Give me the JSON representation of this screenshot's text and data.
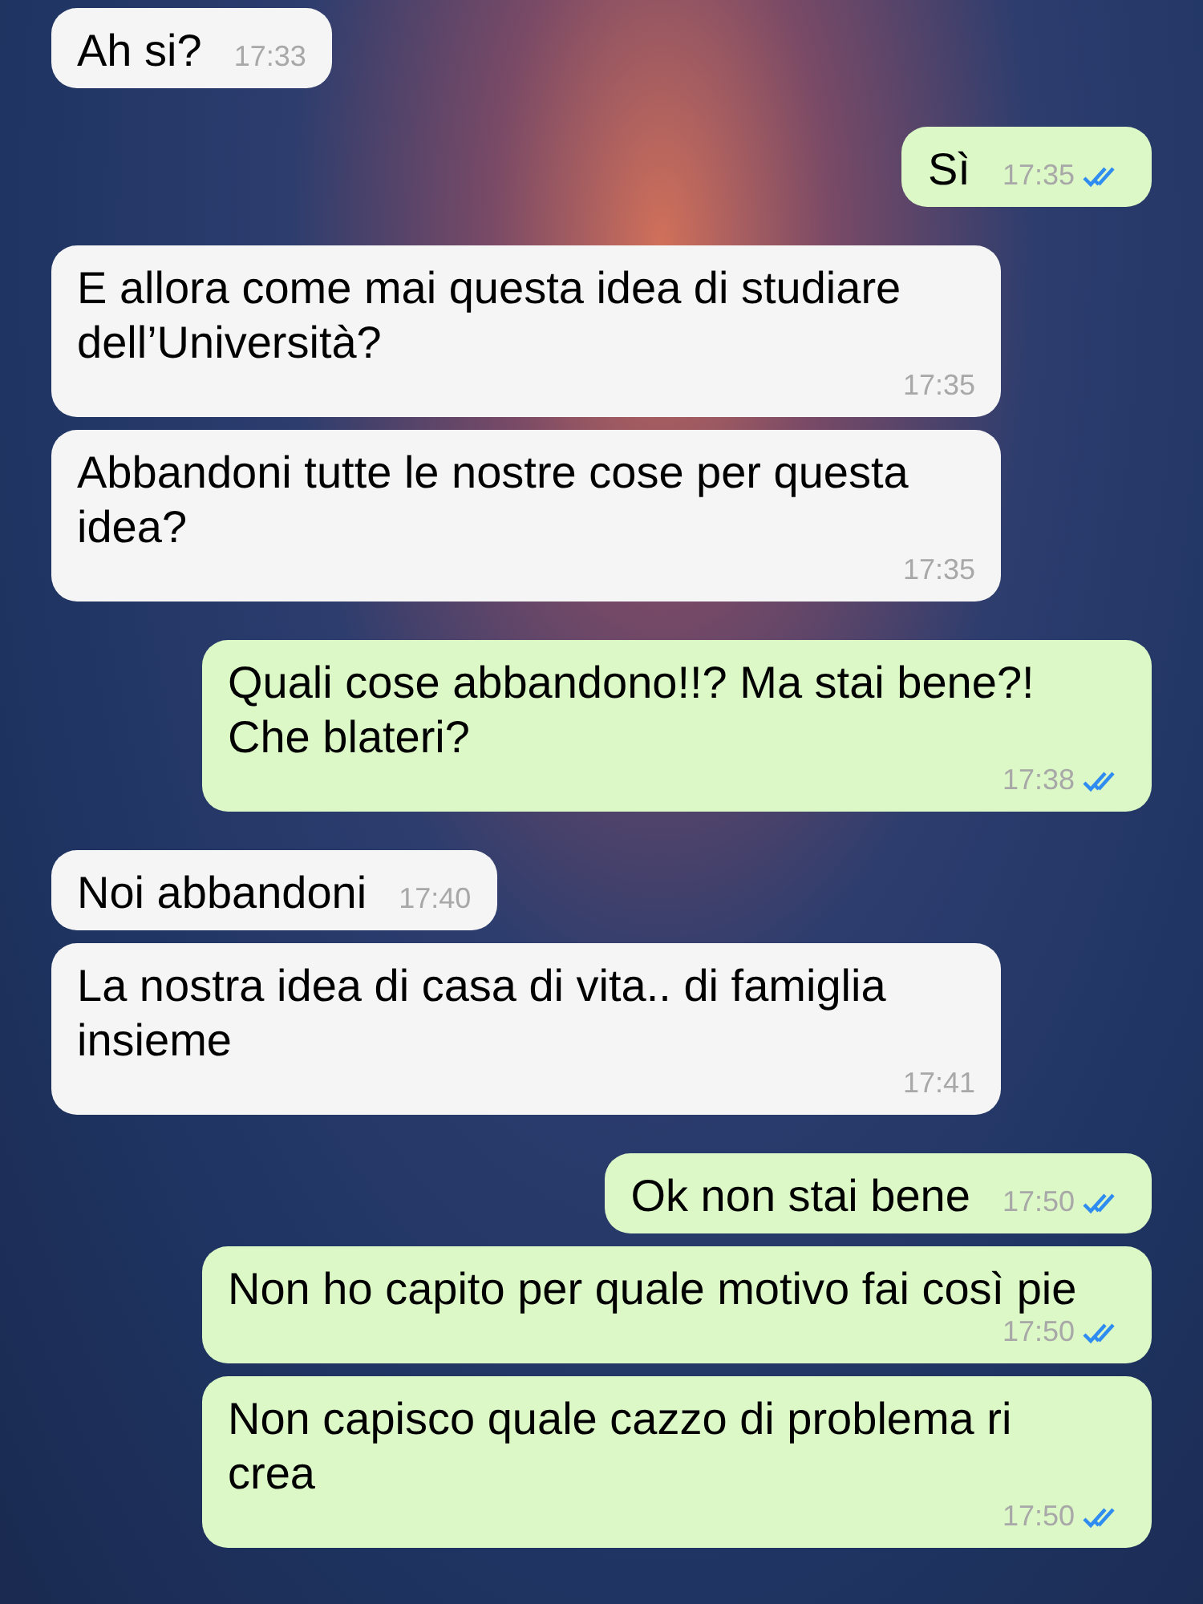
{
  "messages": [
    {
      "kind": "incoming",
      "text": "Ah si?",
      "time": "17:33"
    },
    {
      "kind": "outgoing",
      "text": "Sì",
      "time": "17:35",
      "read": true
    },
    {
      "kind": "incoming",
      "text": "E allora come mai questa idea di studiare dell’Università?",
      "time": "17:35"
    },
    {
      "kind": "incoming",
      "text": "Abbandoni tutte le nostre cose per questa idea?",
      "time": "17:35"
    },
    {
      "kind": "outgoing",
      "text": "Quali cose abbandono!!? Ma stai bene?! Che blateri?",
      "time": "17:38",
      "read": true
    },
    {
      "kind": "incoming",
      "text": "Noi abbandoni",
      "time": "17:40"
    },
    {
      "kind": "incoming",
      "text": "La nostra idea di casa di vita.. di famiglia insieme",
      "time": "17:41"
    },
    {
      "kind": "outgoing",
      "text": "Ok non stai bene",
      "time": "17:50",
      "read": true
    },
    {
      "kind": "outgoing",
      "text": "Non ho capito per quale motivo fai così pie",
      "time": "17:50",
      "read": true
    },
    {
      "kind": "outgoing",
      "text": "Non capisco quale cazzo di problema ri crea",
      "time": "17:50",
      "read": true
    }
  ]
}
